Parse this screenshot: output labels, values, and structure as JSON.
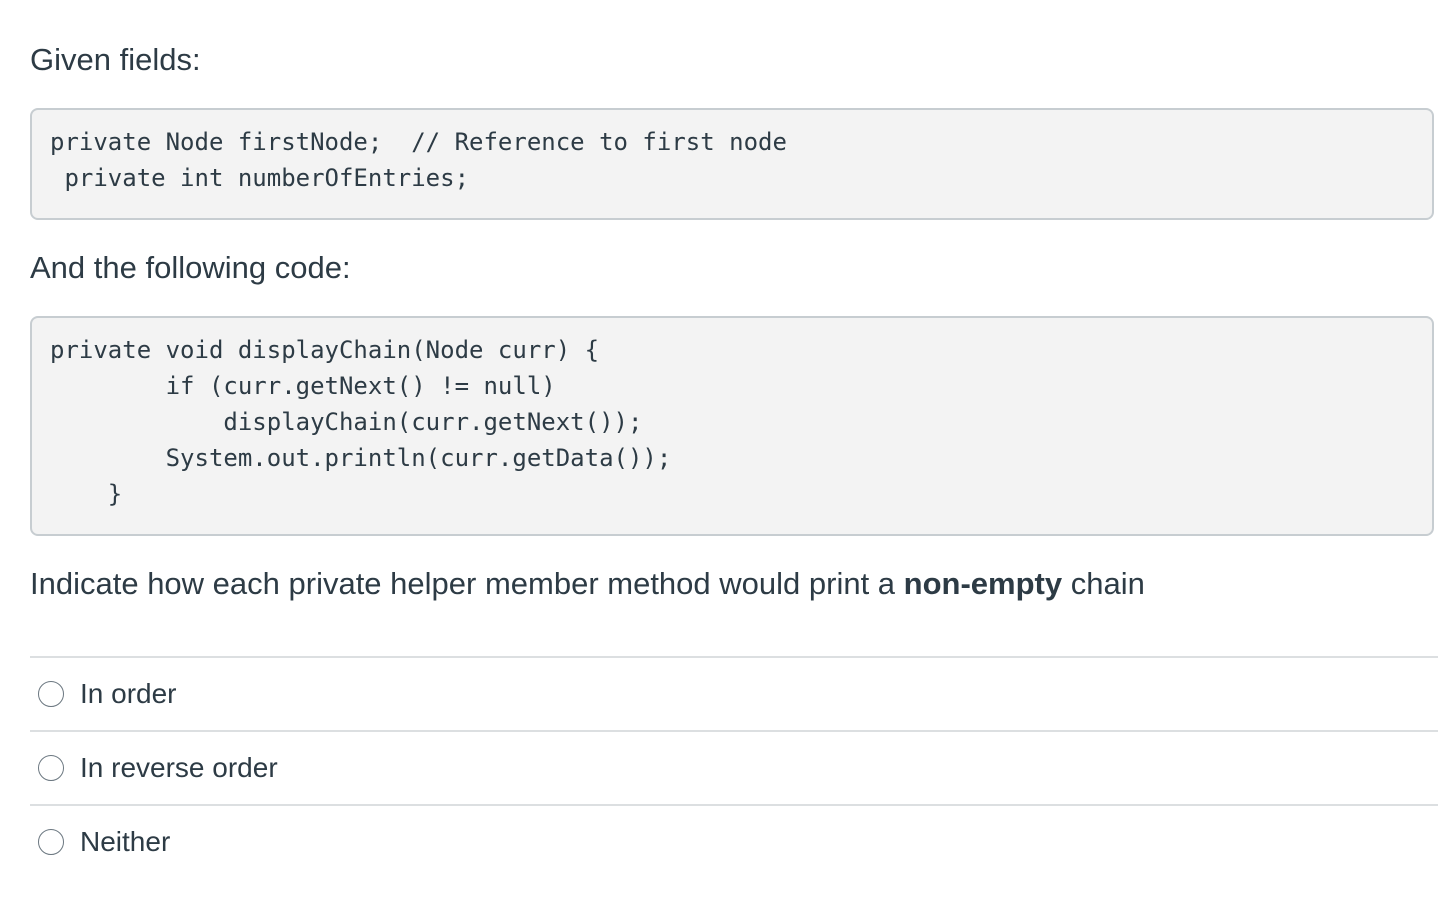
{
  "question": {
    "intro_fields": "Given fields:",
    "fields_code": "private Node firstNode;  // Reference to first node\n private int numberOfEntries;",
    "intro_code": "And the following code:",
    "method_code": "private void displayChain(Node curr) {\n        if (curr.getNext() != null)\n            displayChain(curr.getNext());\n        System.out.println(curr.getData());\n    }",
    "prompt_before": "Indicate how each private helper member method would print a ",
    "prompt_bold": "non-empty",
    "prompt_after": " chain"
  },
  "answers": [
    {
      "label": "In order"
    },
    {
      "label": "In reverse order"
    },
    {
      "label": "Neither"
    }
  ]
}
